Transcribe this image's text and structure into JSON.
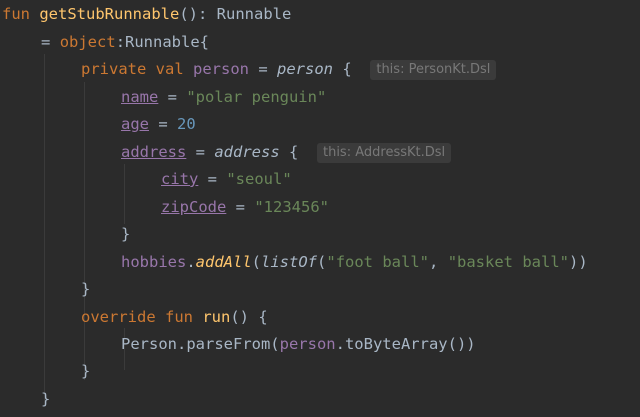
{
  "code": {
    "fun_kw": "fun",
    "fn_name": "getStubRunnable",
    "fn_sig": "(): Runnable",
    "eq": "=",
    "object_kw": "object",
    "object_rest": ":Runnable{",
    "private_kw": "private",
    "val_kw": "val",
    "person_prop": "person",
    "person_builder": "person",
    "hint_person": "this: PersonKt.Dsl",
    "name_prop": "name",
    "name_value": "\"polar penguin\"",
    "age_prop": "age",
    "age_value": "20",
    "address_prop": "address",
    "address_builder": "address",
    "hint_address": "this: AddressKt.Dsl",
    "city_prop": "city",
    "city_value": "\"seoul\"",
    "zip_prop": "zipCode",
    "zip_value": "\"123456\"",
    "close_brace": "}",
    "hobbies": "hobbies",
    "add_all": "addAll",
    "list_of": "listOf",
    "hobby1": "\"foot ball\"",
    "hobby2": "\"basket ball\"",
    "override_kw": "override",
    "run_fn": "run",
    "parse_from": "Person.parseFrom(",
    "person_ref": "person",
    "to_byte_array": ".toByteArray())"
  }
}
